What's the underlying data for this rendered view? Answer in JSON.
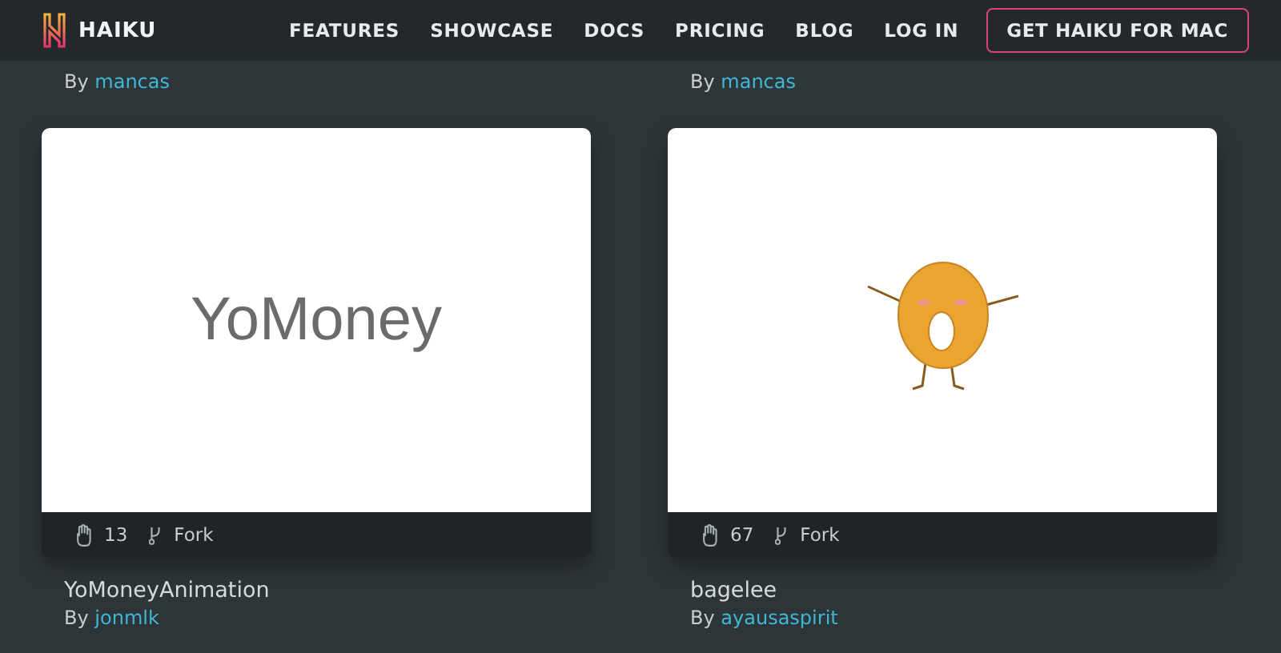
{
  "nav": {
    "brand": "HAIKU",
    "links": [
      {
        "label": "FEATURES"
      },
      {
        "label": "SHOWCASE"
      },
      {
        "label": "DOCS"
      },
      {
        "label": "PRICING"
      },
      {
        "label": "BLOG"
      },
      {
        "label": "LOG IN"
      }
    ],
    "cta": "GET HAIKU FOR MAC"
  },
  "previous_row": [
    {
      "by": "By",
      "author": "mancas"
    },
    {
      "by": "By",
      "author": "mancas"
    }
  ],
  "projects": [
    {
      "preview": {
        "kind": "text",
        "text": "YoMoney"
      },
      "likes": "13",
      "fork": "Fork",
      "title": "YoMoneyAnimation",
      "by": "By",
      "author": "jonmlk"
    },
    {
      "preview": {
        "kind": "bagel"
      },
      "likes": "67",
      "fork": "Fork",
      "title": "bagelee",
      "by": "By",
      "author": "ayausaspirit"
    }
  ]
}
